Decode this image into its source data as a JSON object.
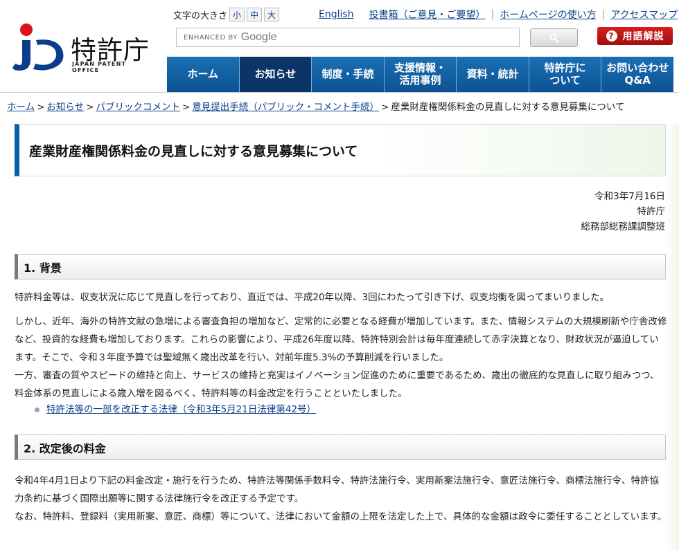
{
  "header": {
    "logo_name": "特許庁",
    "logo_en": "JAPAN PATENT OFFICE",
    "fontsize_label": "文字の大きさ",
    "fontsize_options": [
      "小",
      "中",
      "大"
    ],
    "links": [
      "English",
      "投書箱（ご意見・ご要望）",
      "ホームページの使い方",
      "アクセスマップ"
    ],
    "search_by": "ENHANCED BY",
    "search_brand": "Google",
    "help_label": "用語解説",
    "help_icon": "?"
  },
  "nav": [
    {
      "label": "ホーム"
    },
    {
      "label": "お知らせ"
    },
    {
      "label": "制度・手続"
    },
    {
      "label": "支援情報・\n活用事例"
    },
    {
      "label": "資料・統計"
    },
    {
      "label": "特許庁に\nついて"
    },
    {
      "label": "お問い合わせ\nQ&A"
    }
  ],
  "breadcrumb": {
    "links": [
      "ホーム",
      "お知らせ",
      "パブリックコメント",
      "意見提出手続（パブリック・コメント手続）"
    ],
    "current": "産業財産権関係料金の見直しに対する意見募集について",
    "sep": ">"
  },
  "page": {
    "title": "産業財産権関係料金の見直しに対する意見募集について",
    "date": "令和3年7月16日",
    "org": "特許庁",
    "dept": "総務部総務課調整班"
  },
  "sections": [
    {
      "heading": "1. 背景",
      "paragraphs": [
        "特許料金等は、収支状況に応じて見直しを行っており、直近では、平成20年以降、3回にわたって引き下げ、収支均衡を図ってまいりました。",
        "しかし、近年、海外の特許文献の急増による審査負担の増加など、定常的に必要となる経費が増加しています。また、情報システムの大規模刷新や庁舎改修など、投資的な経費も増加しております。これらの影響により、平成26年度以降、特許特別会計は毎年度連続して赤字決算となり、財政状況が逼迫しています。そこで、令和３年度予算では聖域無く歳出改革を行い、対前年度5.3%の予算削減を行いました。",
        "一方、審査の質やスピードの維持と向上、サービスの維持と充実はイノベーション促進のために重要であるため、歳出の徹底的な見直しに取り組みつつ、料金体系の見直しによる歳入増を図るべく、特許料等の料金改定を行うことといたしました。"
      ],
      "link": "特許法等の一部を改正する法律（令和3年5月21日法律第42号）"
    },
    {
      "heading": "2. 改定後の料金",
      "paragraphs": [
        "令和4年4月1日より下記の料金改定・施行を行うため、特許法等関係手数料令、特許法施行令、実用新案法施行令、意匠法施行令、商標法施行令、特許協力条約に基づく国際出願等に関する法律施行令を改正する予定です。",
        "なお、特許料、登録料（実用新案、意匠、商標）等について、法律において金額の上限を法定した上で、具体的な金額は政令に委任することとしています。"
      ]
    }
  ]
}
